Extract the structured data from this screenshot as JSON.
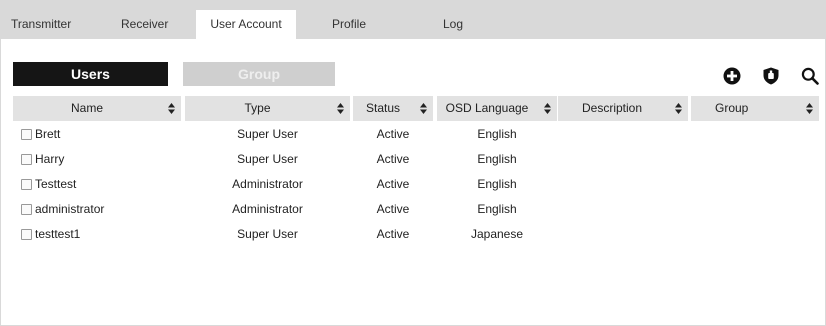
{
  "tabs": [
    "Transmitter",
    "Receiver",
    "User Account",
    "Profile",
    "Log"
  ],
  "active_tab": "User Account",
  "subtabs": {
    "users": "Users",
    "group": "Group"
  },
  "toolbar": {
    "add_icon": "plus-circle-icon",
    "badge_icon": "shield-icon",
    "search_icon": "search-icon"
  },
  "columns": [
    "Name",
    "Type",
    "Status",
    "OSD Language",
    "Description",
    "Group"
  ],
  "rows": [
    {
      "name": "Brett",
      "type": "Super User",
      "status": "Active",
      "lang": "English",
      "desc": "",
      "group": ""
    },
    {
      "name": "Harry",
      "type": "Super User",
      "status": "Active",
      "lang": "English",
      "desc": "",
      "group": ""
    },
    {
      "name": "Testtest",
      "type": "Administrator",
      "status": "Active",
      "lang": "English",
      "desc": "",
      "group": ""
    },
    {
      "name": "administrator",
      "type": "Administrator",
      "status": "Active",
      "lang": "English",
      "desc": "",
      "group": ""
    },
    {
      "name": "testtest1",
      "type": "Super User",
      "status": "Active",
      "lang": "Japanese",
      "desc": "",
      "group": ""
    }
  ]
}
